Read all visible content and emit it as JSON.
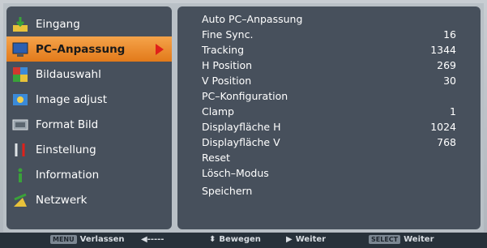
{
  "menu": [
    {
      "label": "Eingang",
      "icon": "input-icon",
      "selected": false
    },
    {
      "label": "PC–Anpassung",
      "icon": "pc-adjust-icon",
      "selected": true
    },
    {
      "label": "Bildauswahl",
      "icon": "image-select-icon",
      "selected": false
    },
    {
      "label": "Image adjust",
      "icon": "image-adjust-icon",
      "selected": false
    },
    {
      "label": "Format Bild",
      "icon": "screen-format-icon",
      "selected": false
    },
    {
      "label": "Einstellung",
      "icon": "settings-icon",
      "selected": false
    },
    {
      "label": "Information",
      "icon": "information-icon",
      "selected": false
    },
    {
      "label": "Netzwerk",
      "icon": "network-icon",
      "selected": false
    }
  ],
  "panel": [
    {
      "label": "Auto PC–Anpassung",
      "value": ""
    },
    {
      "label": "Fine Sync.",
      "value": "16"
    },
    {
      "label": "Tracking",
      "value": "1344"
    },
    {
      "label": "H Position",
      "value": "269"
    },
    {
      "label": "V Position",
      "value": "30"
    },
    {
      "label": "PC–Konfiguration",
      "value": ""
    },
    {
      "label": "Clamp",
      "value": "1"
    },
    {
      "label": "Displayfläche H",
      "value": "1024"
    },
    {
      "label": "Displayfläche V",
      "value": "768"
    },
    {
      "label": "Reset",
      "value": ""
    },
    {
      "label": "Lösch–Modus",
      "value": ""
    },
    {
      "label": "Speichern",
      "value": ""
    }
  ],
  "bottombar": {
    "exit_tag": "MENU",
    "exit_label": "Verlassen",
    "back_label": "◀-----",
    "move_label": "Bewegen",
    "next_label": "Weiter",
    "select_tag": "SELECT",
    "select_label": "Weiter"
  },
  "colors": {
    "panel_bg": "#47505c",
    "selected_bg": "#f09a3e",
    "arrow": "#e0201a",
    "frame": "#b9c0c6"
  }
}
